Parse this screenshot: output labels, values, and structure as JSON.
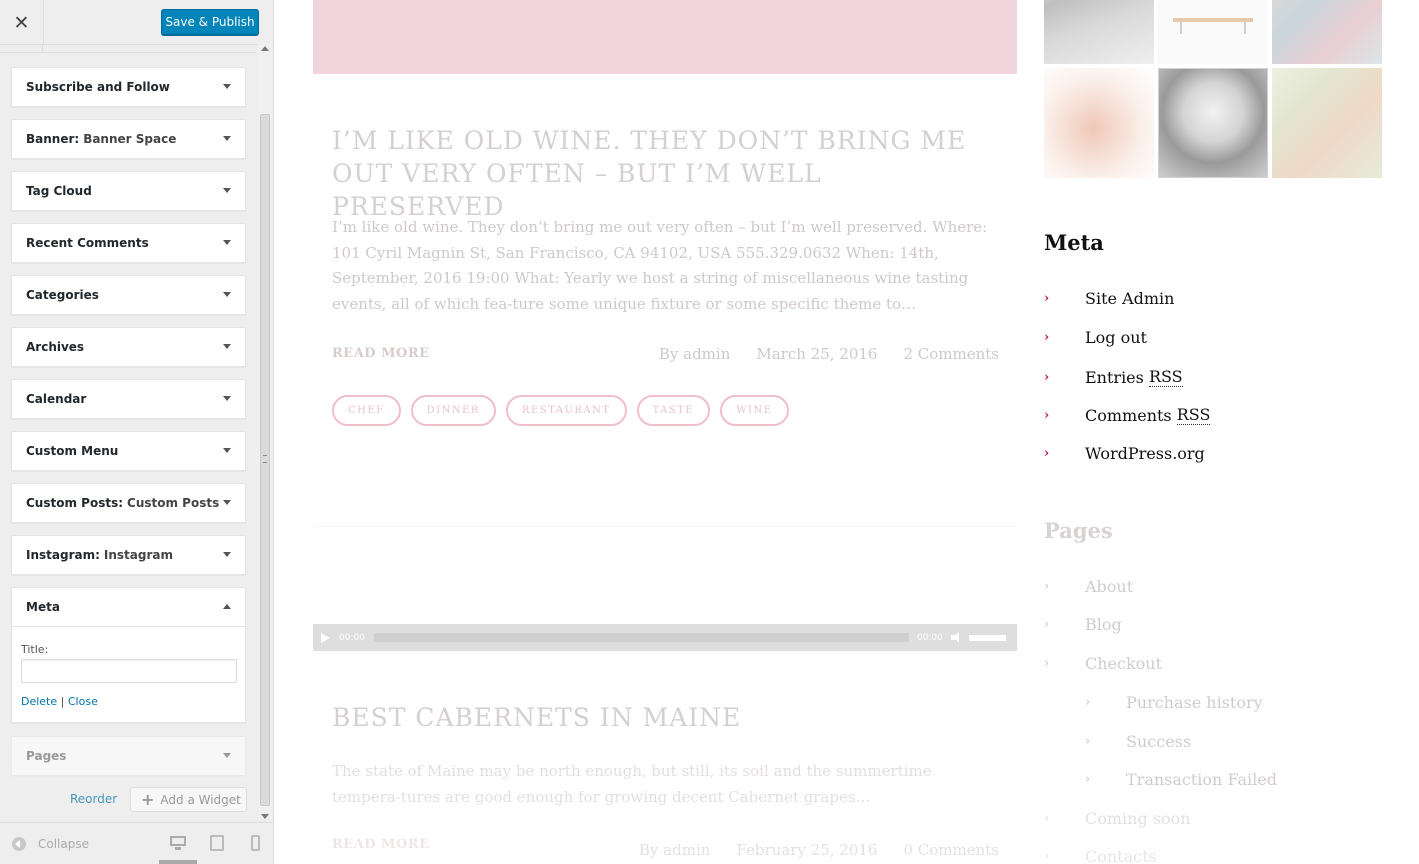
{
  "customizer": {
    "save_label": "Save & Publish",
    "close_glyph": "✕",
    "widgets": [
      {
        "title": "Subscribe and Follow",
        "sub": ""
      },
      {
        "title": "Banner:",
        "sub": "Banner Space"
      },
      {
        "title": "Tag Cloud",
        "sub": ""
      },
      {
        "title": "Recent Comments",
        "sub": ""
      },
      {
        "title": "Categories",
        "sub": ""
      },
      {
        "title": "Archives",
        "sub": ""
      },
      {
        "title": "Calendar",
        "sub": ""
      },
      {
        "title": "Custom Menu",
        "sub": ""
      },
      {
        "title": "Custom Posts:",
        "sub": "Custom Posts"
      },
      {
        "title": "Instagram:",
        "sub": "Instagram"
      }
    ],
    "meta_widget": {
      "title": "Meta",
      "title_label": "Title:",
      "title_value": "",
      "delete_label": "Delete",
      "separator": "|",
      "close_label": "Close"
    },
    "pages_widget": {
      "title": "Pages"
    },
    "reorder_label": "Reorder",
    "add_widget_label": "Add a Widget",
    "collapse_label": "Collapse",
    "accent_color": "#0085ba"
  },
  "preview": {
    "post1": {
      "title": "I’M LIKE OLD WINE. THEY DON’T BRING ME OUT VERY OFTEN – BUT I’M WELL PRESERVED",
      "excerpt": "I’m like old wine. They don’t bring me out very often – but I’m well preserved. Where: 101 Cyril Magnin St, San Francisco, CA 94102, USA 555.329.0632 When: 14th, September, 2016 19:00 What: Yearly we host a string of miscellaneous wine tasting events, all of which fea-ture some unique fixture or some specific theme to…",
      "read_more": "READ MORE",
      "author": "By admin",
      "date": "March 25, 2016",
      "comments": "2 Comments",
      "tags": [
        "CHEF",
        "DINNER",
        "RESTAURANT",
        "TASTE",
        "WINE"
      ]
    },
    "audio": {
      "current": "00:00",
      "duration": "00:00",
      "volume": 0.8
    },
    "post2": {
      "title": "BEST CABERNETS IN MAINE",
      "excerpt": "The state of Maine may be north enough, but still, its soil and the summertime tempera-tures are good enough for growing decent Cabernet grapes…",
      "read_more": "READ MORE",
      "author": "By admin",
      "date": "February 25, 2016",
      "comments": "0 Comments"
    },
    "meta_heading": "Meta",
    "meta_links": [
      {
        "text": "Site Admin",
        "abbr": ""
      },
      {
        "text": "Log out",
        "abbr": ""
      },
      {
        "text": "Entries ",
        "abbr": "RSS"
      },
      {
        "text": "Comments ",
        "abbr": "RSS"
      },
      {
        "text": "WordPress.org",
        "abbr": ""
      }
    ],
    "pages_heading": "Pages",
    "pages_links": [
      "About",
      "Blog",
      "Checkout"
    ],
    "pages_sub_links": [
      "Purchase history",
      "Success",
      "Transaction Failed"
    ],
    "pages_more_links": [
      "Coming soon",
      "Contacts"
    ],
    "chevron": "›",
    "link_accent": "#c2185b"
  }
}
